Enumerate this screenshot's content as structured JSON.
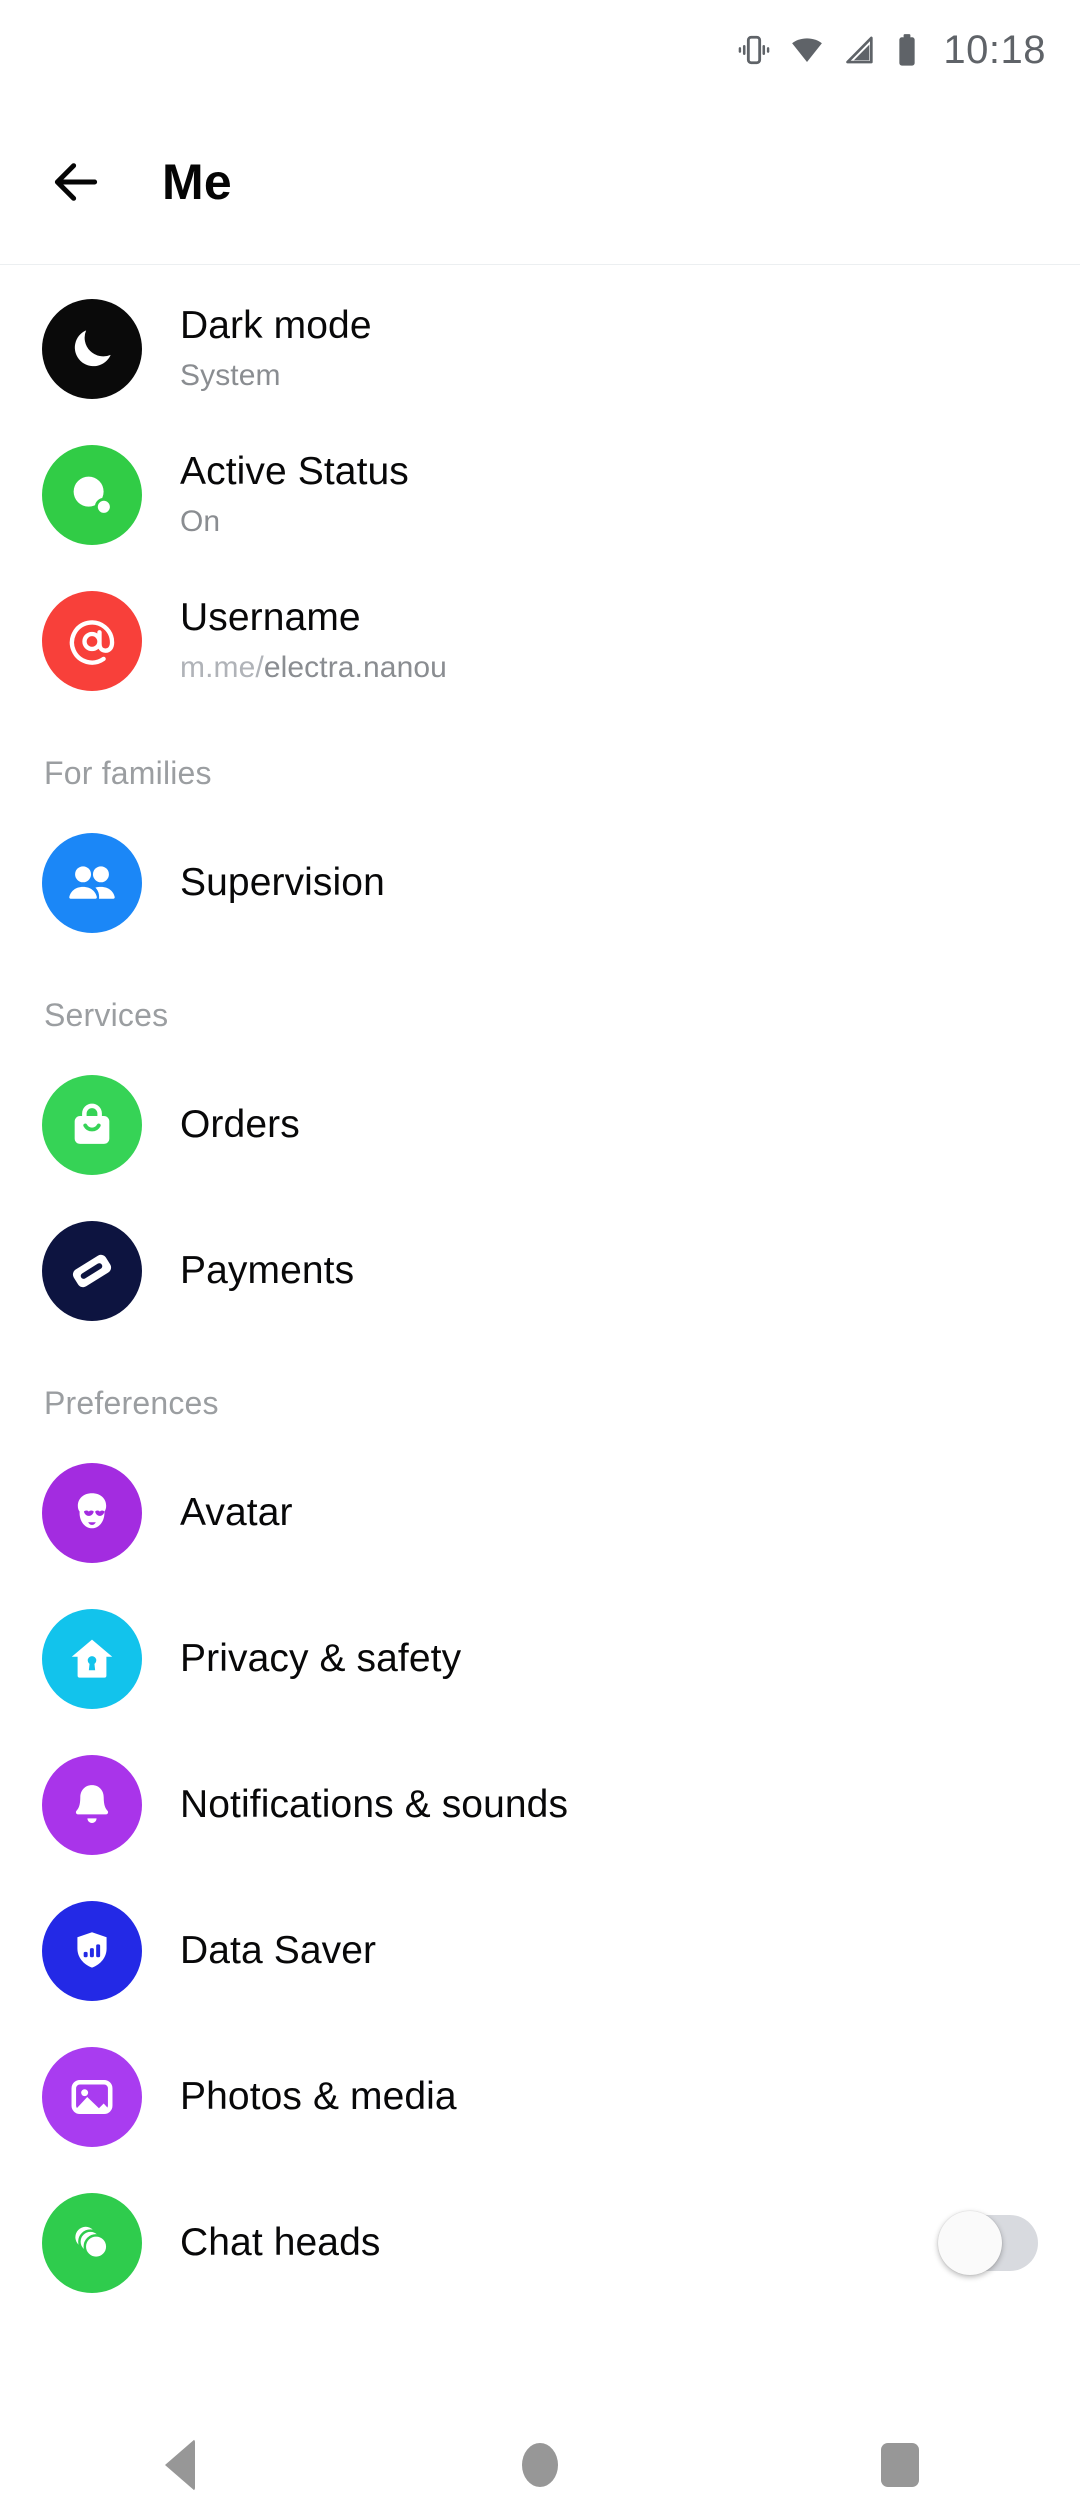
{
  "status_bar": {
    "time": "10:18",
    "icons": [
      "vibrate-icon",
      "wifi-icon",
      "cellular-signal-icon",
      "battery-icon"
    ]
  },
  "header": {
    "title": "Me",
    "back_icon": "back-arrow-icon"
  },
  "account_items": [
    {
      "id": "dark-mode",
      "label": "Dark mode",
      "value": "System",
      "icon": "moon-icon",
      "color": "#0a0a0a"
    },
    {
      "id": "active-status",
      "label": "Active Status",
      "value": "On",
      "icon": "active-status-icon",
      "color": "#31cc46"
    },
    {
      "id": "username",
      "label": "Username",
      "value_dim": "m.me/",
      "value": "electra.nanou",
      "icon": "at-sign-icon",
      "color": "#f8403a"
    }
  ],
  "sections": [
    {
      "title": "For families",
      "items": [
        {
          "id": "supervision",
          "label": "Supervision",
          "icon": "people-icon",
          "color": "#1b87f7"
        }
      ]
    },
    {
      "title": "Services",
      "items": [
        {
          "id": "orders",
          "label": "Orders",
          "icon": "shopping-bag-icon",
          "color": "#36d356"
        },
        {
          "id": "payments",
          "label": "Payments",
          "icon": "credit-card-icon",
          "color": "#0d1440"
        }
      ]
    },
    {
      "title": "Preferences",
      "items": [
        {
          "id": "avatar",
          "label": "Avatar",
          "icon": "avatar-face-icon",
          "color": "#a32ce0"
        },
        {
          "id": "privacy-safety",
          "label": "Privacy & safety",
          "icon": "home-lock-icon",
          "color": "#12c3ec"
        },
        {
          "id": "notifications-sounds",
          "label": "Notifications & sounds",
          "icon": "bell-icon",
          "color": "#a934ea"
        },
        {
          "id": "data-saver",
          "label": "Data Saver",
          "icon": "shield-bars-icon",
          "color": "#2329e6"
        },
        {
          "id": "photos-media",
          "label": "Photos & media",
          "icon": "photo-icon",
          "color": "#a93cf0"
        },
        {
          "id": "chat-heads",
          "label": "Chat heads",
          "icon": "chat-heads-icon",
          "color": "#2fcc4d",
          "toggle": "off"
        }
      ]
    }
  ],
  "nav_bar": {
    "back": "nav-back-icon",
    "home": "nav-home-icon",
    "recents": "nav-recents-icon"
  }
}
